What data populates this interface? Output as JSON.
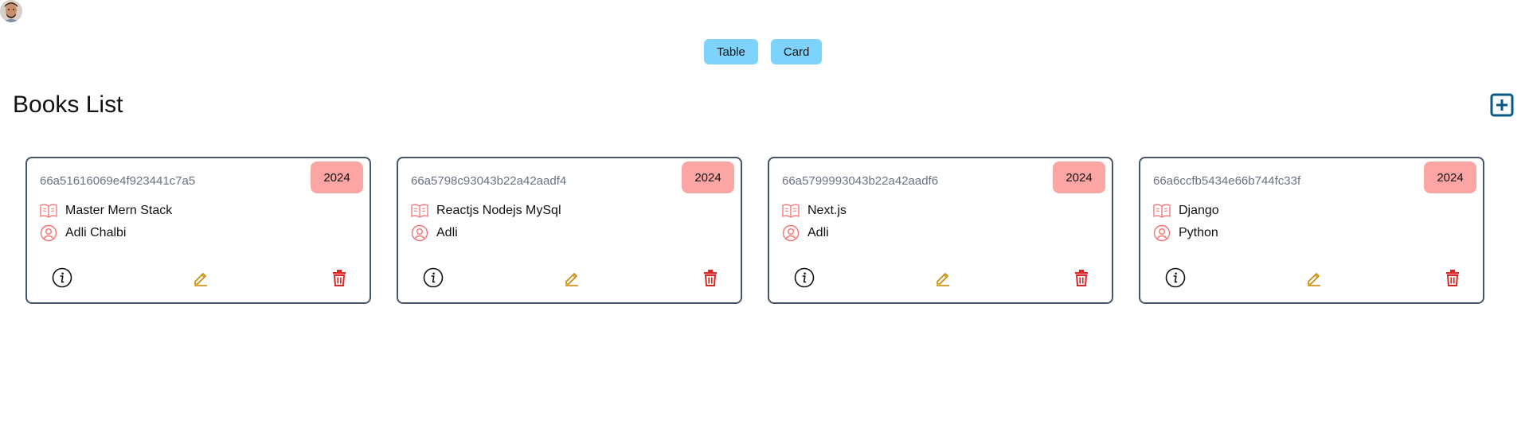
{
  "view_toggle": {
    "table_label": "Table",
    "card_label": "Card"
  },
  "header": {
    "title": "Books List"
  },
  "colors": {
    "toggle_bg": "#7dd3fc",
    "badge_bg": "#fca5a5",
    "icon_pink": "#f87171",
    "edit_color": "#ca8a04",
    "delete_color": "#dc2626",
    "add_color": "#075985",
    "card_border": "#475569"
  },
  "icons": {
    "avatar": "user-photo",
    "add": "plus-square-icon",
    "title": "open-book-icon",
    "author": "user-circle-icon",
    "info": "info-circle-icon",
    "edit": "pencil-icon",
    "delete": "trash-icon"
  },
  "books": [
    {
      "id": "66a51616069e4f923441c7a5",
      "year": "2024",
      "title": "Master Mern Stack",
      "author": "Adli Chalbi"
    },
    {
      "id": "66a5798c93043b22a42aadf4",
      "year": "2024",
      "title": "Reactjs Nodejs MySql",
      "author": "Adli"
    },
    {
      "id": "66a5799993043b22a42aadf6",
      "year": "2024",
      "title": "Next.js",
      "author": "Adli"
    },
    {
      "id": "66a6ccfb5434e66b744fc33f",
      "year": "2024",
      "title": "Django",
      "author": "Python"
    }
  ]
}
